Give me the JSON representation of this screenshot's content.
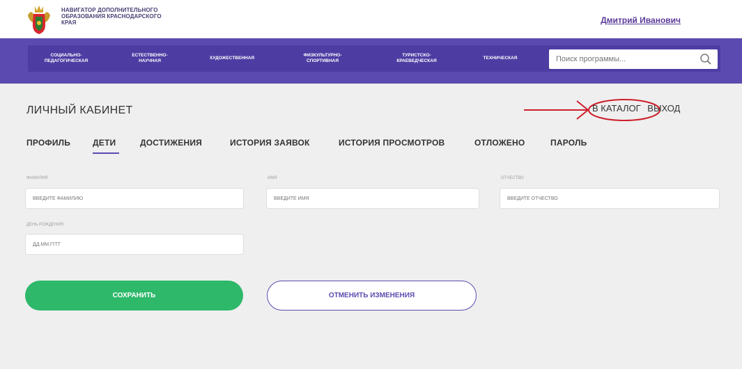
{
  "header": {
    "brand_lines": [
      "НАВИГАТОР ДОПОЛНИТЕЛЬНОГО",
      "ОБРАЗОВАНИЯ КРАСНОДАРСКОГО",
      "КРАЯ"
    ],
    "user_name": "Дмитрий Иванович"
  },
  "nav": {
    "items": [
      {
        "lines": [
          "СОЦИАЛЬНО-",
          "ПЕДАГОГИЧЕСКАЯ"
        ]
      },
      {
        "lines": [
          "ЕСТЕСТВЕННО-",
          "НАУЧНАЯ"
        ]
      },
      {
        "lines": [
          "ХУДОЖЕСТВЕННАЯ"
        ]
      },
      {
        "lines": [
          "ФИЗКУЛЬТУРНО-",
          "СПОРТИВНАЯ"
        ]
      },
      {
        "lines": [
          "ТУРИСТСКО-",
          "КРАЕВЕДЧЕСКАЯ"
        ]
      },
      {
        "lines": [
          "ТЕХНИЧЕСКАЯ"
        ]
      }
    ],
    "search_placeholder": "Поиск программы..."
  },
  "page": {
    "title": "ЛИЧНЫЙ КАБИНЕТ",
    "catalog_link": "В КАТАЛОГ",
    "logout_link": "ВЫХОД"
  },
  "tabs": [
    "ПРОФИЛЬ",
    "ДЕТИ",
    "ДОСТИЖЕНИЯ",
    "ИСТОРИЯ ЗАЯВОК",
    "ИСТОРИЯ ПРОСМОТРОВ",
    "ОТЛОЖЕНО",
    "ПАРОЛЬ"
  ],
  "active_tab": "ДЕТИ",
  "form": {
    "lastname": {
      "label": "ФАМИЛИЯ",
      "placeholder": "ВВЕДИТЕ ФАМИЛИЮ"
    },
    "firstname": {
      "label": "ИМЯ",
      "placeholder": "ВВЕДИТЕ ИМЯ"
    },
    "patronymic": {
      "label": "ОТЧЕСТВО",
      "placeholder": "ВВЕДИТЕ ОТЧЕСТВО"
    },
    "birthdate": {
      "label": "ДЕНЬ РОЖДЕНИЯ",
      "placeholder": "ДД.ММ.ГГГГ"
    }
  },
  "buttons": {
    "save": "СОХРАНИТЬ",
    "cancel": "ОТМЕНИТЬ ИЗМЕНЕНИЯ"
  },
  "colors": {
    "nav_bg": "#5b4bb0",
    "save_button": "#2db86a",
    "annotation": "#cc1f2a"
  },
  "icons": {
    "search": "search-icon",
    "logo": "coat-of-arms-icon"
  }
}
